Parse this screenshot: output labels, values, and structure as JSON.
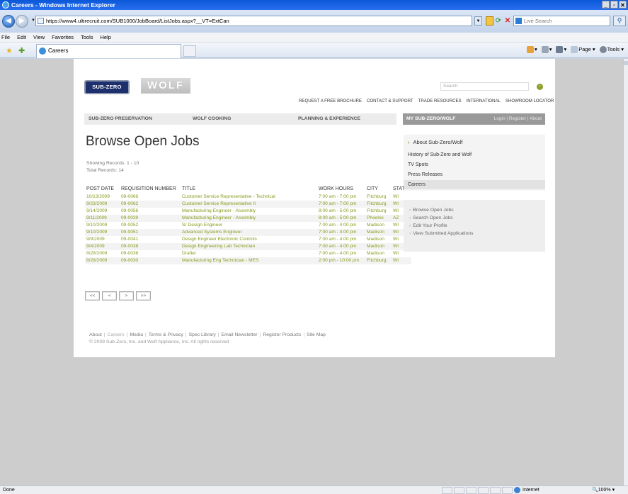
{
  "browser": {
    "title": "Careers - Windows Internet Explorer",
    "url": "https://www4.ultirecruit.com/SUB1000/JobBoard/ListJobs.aspx?__VT=ExtCan",
    "search_placeholder": "Live Search",
    "menu": [
      "File",
      "Edit",
      "View",
      "Favorites",
      "Tools",
      "Help"
    ],
    "tab_label": "Careers",
    "cmd_page": "Page",
    "cmd_tools": "Tools",
    "status": "Done",
    "zone": "Internet",
    "zoom": "100%"
  },
  "site": {
    "logo_subzero": "SUB-ZERO",
    "logo_wolf": "WOLF",
    "search_placeholder": "Search",
    "util_nav": [
      "REQUEST A FREE BROCHURE",
      "CONTACT & SUPPORT",
      "TRADE RESOURCES",
      "INTERNATIONAL",
      "SHOWROOM LOCATOR"
    ],
    "main_nav": [
      "SUB-ZERO PRESERVATION",
      "WOLF COOKING",
      "PLANNING & EXPERIENCE"
    ],
    "my_label": "MY SUB-ZERO/WOLF",
    "my_links": "Login | Register | About"
  },
  "content": {
    "title": "Browse Open Jobs",
    "showing": "Showing Records: 1 - 10",
    "total": "Total Records: 14",
    "columns": [
      "POST DATE",
      "REQUISITION NUMBER",
      "TITLE",
      "WORK HOURS",
      "CITY",
      "STATE"
    ],
    "rows": [
      [
        "10/13/2009",
        "09-0066",
        "Customer Service Representative - Technical",
        "7:00 am - 7:00 pm",
        "Fitchburg",
        "WI"
      ],
      [
        "9/23/2009",
        "09-0062",
        "Customer Service Representative II",
        "7:00 am - 7:00 pm",
        "Fitchburg",
        "WI"
      ],
      [
        "9/14/2009",
        "09-0056",
        "Manufacturing Engineer - Assembly",
        "8:00 am - 5:00 pm",
        "Fitchburg",
        "WI"
      ],
      [
        "9/11/2009",
        "09-0039",
        "Manufacturing Engineer - Assembly",
        "8:00 am - 5:00 pm",
        "Phoenix",
        "AZ"
      ],
      [
        "9/10/2009",
        "09-0052",
        "Sr Design Engineer",
        "7:00 am - 4:00 pm",
        "Madison",
        "WI"
      ],
      [
        "9/10/2009",
        "09-0051",
        "Advanced Systems Engineer",
        "7:00 am - 4:00 pm",
        "Madison",
        "WI"
      ],
      [
        "9/9/2009",
        "09-0041",
        "Design Engineer Electronic Controls",
        "7:00 am - 4:00 pm",
        "Madison",
        "WI"
      ],
      [
        "9/4/2009",
        "09-0038",
        "Design Engineering Lab Technician",
        "7:00 am - 4:00 pm",
        "Madison",
        "WI"
      ],
      [
        "8/28/2009",
        "09-0036",
        "Drafter",
        "7:00 am - 4:00 pm",
        "Madison",
        "WI"
      ],
      [
        "8/28/2009",
        "09-0030",
        "Manufacturing Eng Technician - MES",
        "2:00 pm - 10:00 pm",
        "Fitchburg",
        "WI"
      ]
    ],
    "pager": [
      "<<",
      "<",
      ">",
      ">>"
    ]
  },
  "sidebar": {
    "head": "About Sub-Zero/Wolf",
    "items": [
      "History of Sub-Zero and Wolf",
      "TV Spots",
      "Press Releases",
      "Careers"
    ],
    "links": [
      "Browse Open Jobs",
      "Search Open Jobs",
      "Edit Your Profile",
      "View Submitted Applications"
    ]
  },
  "footer": {
    "links": [
      "About",
      "Careers",
      "Media",
      "Terms & Privacy",
      "Spec Library",
      "Email Newsletter",
      "Register Products",
      "Site Map"
    ],
    "copyright": "© 2009 Sub-Zero, Inc. and Wolf Appliance, Inc. All rights reserved"
  }
}
